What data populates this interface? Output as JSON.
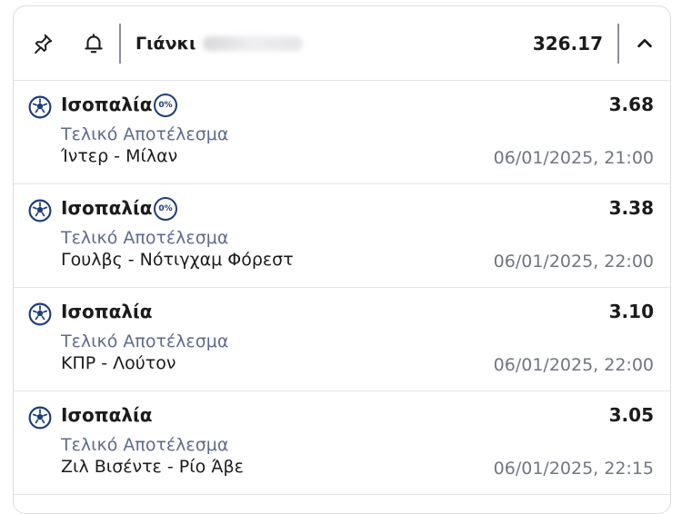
{
  "header": {
    "name": "Γιάνκι",
    "total": "326.17"
  },
  "bets": [
    {
      "market": "Ισοπαλία",
      "badge": "0%",
      "odds": "3.68",
      "type": "Τελικό Αποτέλεσμα",
      "match": "Ίντερ - Μίλαν",
      "datetime": "06/01/2025, 21:00"
    },
    {
      "market": "Ισοπαλία",
      "badge": "0%",
      "odds": "3.38",
      "type": "Τελικό Αποτέλεσμα",
      "match": "Γουλβς - Νότιγχαμ Φόρεστ",
      "datetime": "06/01/2025, 22:00"
    },
    {
      "market": "Ισοπαλία",
      "badge": null,
      "odds": "3.10",
      "type": "Τελικό Αποτέλεσμα",
      "match": "ΚΠΡ - Λούτον",
      "datetime": "06/01/2025, 22:00"
    },
    {
      "market": "Ισοπαλία",
      "badge": null,
      "odds": "3.05",
      "type": "Τελικό Αποτέλεσμα",
      "match": "Ζιλ Βισέντε - Ρίο Άβε",
      "datetime": "06/01/2025, 22:15"
    }
  ],
  "icons": {
    "pin": "pin-icon",
    "bell": "bell-icon",
    "collapse": "chevron-up-icon",
    "sport": "soccer-ball-icon",
    "badge": "percent-badge-icon"
  },
  "colors": {
    "accent": "#1f3d7a",
    "subtext": "#5e6b8c",
    "muted": "#707682",
    "border": "#dcdde1"
  }
}
